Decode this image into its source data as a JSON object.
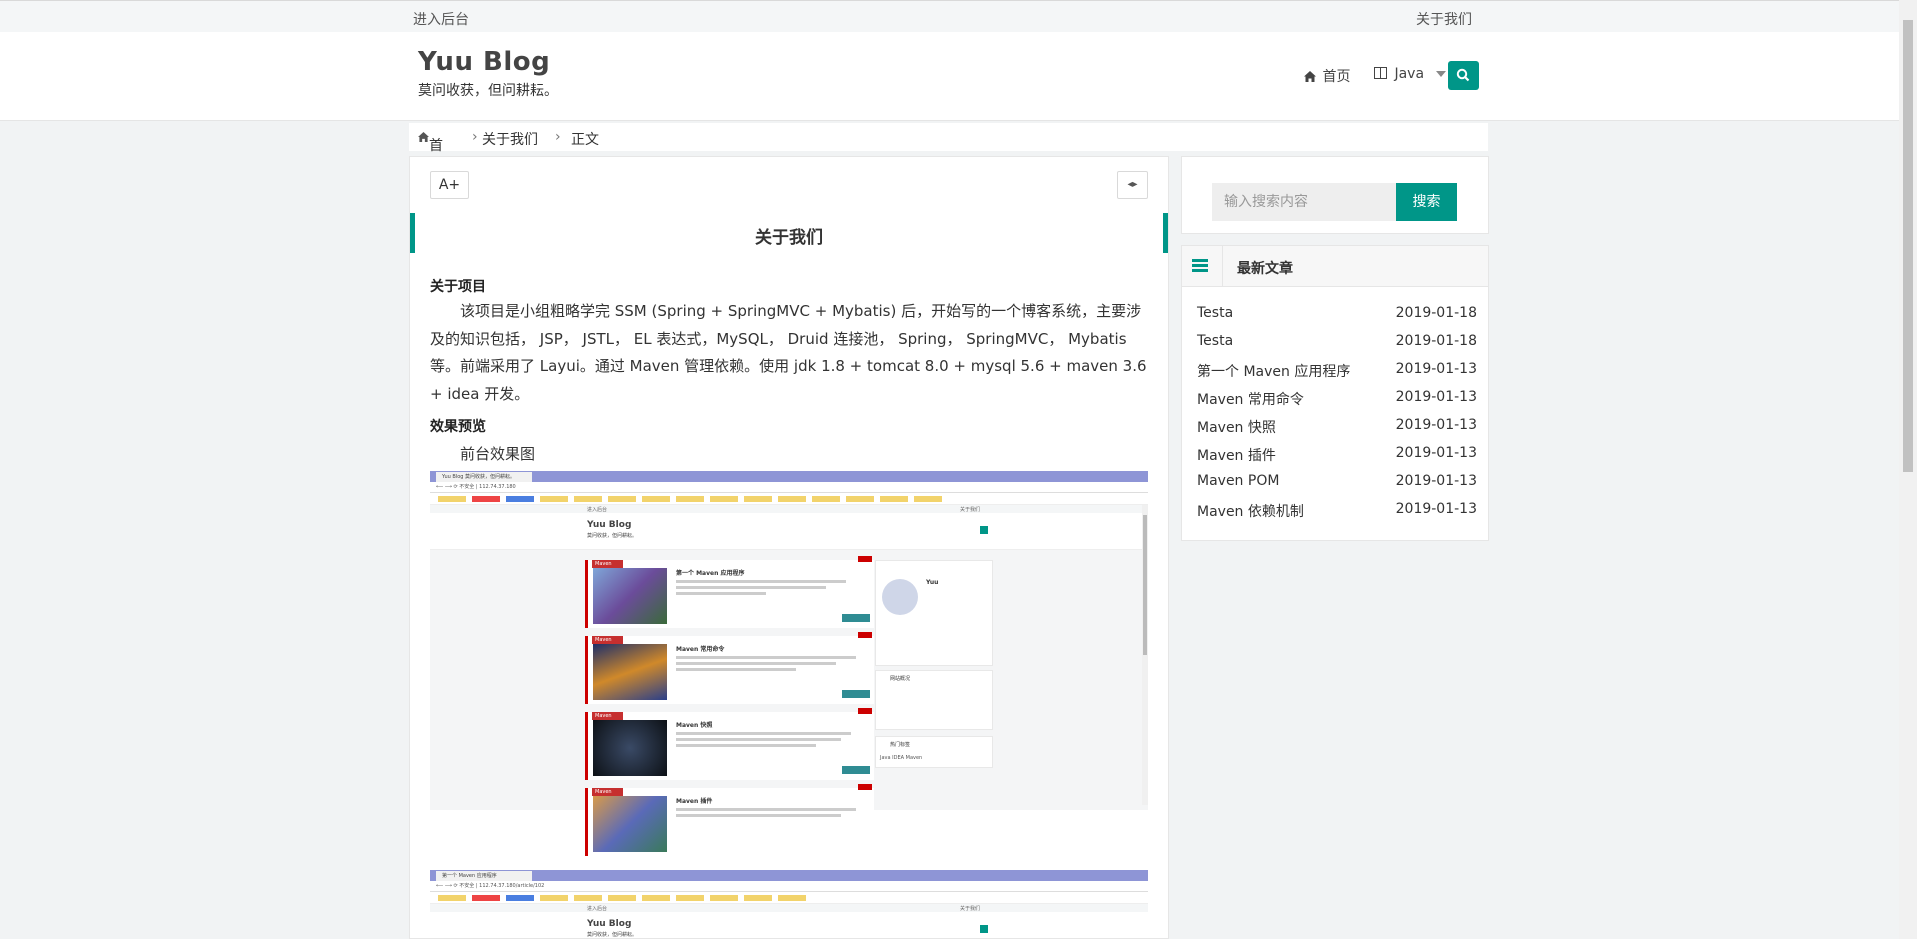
{
  "topbar": {
    "left_link": "进入后台",
    "right_link": "关于我们"
  },
  "header": {
    "logo": "Yuu Blog",
    "slogan": "莫问收获，但问耕耘。",
    "nav": {
      "home": "首页",
      "java": "Java"
    },
    "search_icon": "search-icon"
  },
  "breadcrumb": {
    "home": "首页",
    "category": "关于我们",
    "current": "正文"
  },
  "article": {
    "font_button": "A+",
    "code_button": "◂▸",
    "title": "关于我们",
    "section1_heading": "关于项目",
    "section1_text": "该项目是小组粗略学完 SSM (Spring + SpringMVC + Mybatis) 后，开始写的一个博客系统，主要涉及的知识包括， JSP， JSTL， EL 表达式，MySQL， Druid 连接池， Spring， SpringMVC， Mybatis 等。前端采用了 Layui。通过 Maven 管理依赖。使用 jdk 1.8 + tomcat 8.0 + mysql 5.6 + maven 3.6 + idea 开发。",
    "section2_heading": "效果预览",
    "section2_text": "前台效果图"
  },
  "screenshot1": {
    "tab": "Yuu Blog 莫问收获，但问耕耘。",
    "address": "⟵ ⟶ ⟳  不安全 | 112.74.37.180",
    "top_left": "进入后台",
    "top_right": "关于我们",
    "logo": "Yuu Blog",
    "slogan": "莫问收获，但问耕耘。",
    "cards": [
      {
        "tag": "Maven",
        "title": "第一个 Maven 应用程序"
      },
      {
        "tag": "Maven",
        "title": "Maven 常用命令"
      },
      {
        "tag": "Maven",
        "title": "Maven 快照"
      },
      {
        "tag": "Maven",
        "title": "Maven 插件"
      }
    ],
    "profile_name": "Yuu",
    "side_sections": [
      "网站概况",
      "热门标签"
    ],
    "tags": "Java  IDEA  Maven"
  },
  "screenshot2": {
    "tab": "第一个 Maven 应用程序",
    "address": "⟵ ⟶ ⟳  不安全 | 112.74.37.180/article/102",
    "top_left": "进入后台",
    "top_right": "关于我们",
    "logo": "Yuu Blog",
    "slogan": "莫问收获，但问耕耘。"
  },
  "sidebar": {
    "search_placeholder": "输入搜索内容",
    "search_button": "搜索",
    "recent_title": "最新文章",
    "recent": [
      {
        "title": "Testa",
        "date": "2019-01-18"
      },
      {
        "title": "Testa",
        "date": "2019-01-18"
      },
      {
        "title": "第一个 Maven 应用程序",
        "date": "2019-01-13"
      },
      {
        "title": "Maven 常用命令",
        "date": "2019-01-13"
      },
      {
        "title": "Maven 快照",
        "date": "2019-01-13"
      },
      {
        "title": "Maven 插件",
        "date": "2019-01-13"
      },
      {
        "title": "Maven POM",
        "date": "2019-01-13"
      },
      {
        "title": "Maven 依赖机制",
        "date": "2019-01-13"
      }
    ]
  },
  "colors": {
    "accent": "#009688",
    "tag_red": "#c62f2f",
    "page_bg": "#f1f3f4"
  }
}
